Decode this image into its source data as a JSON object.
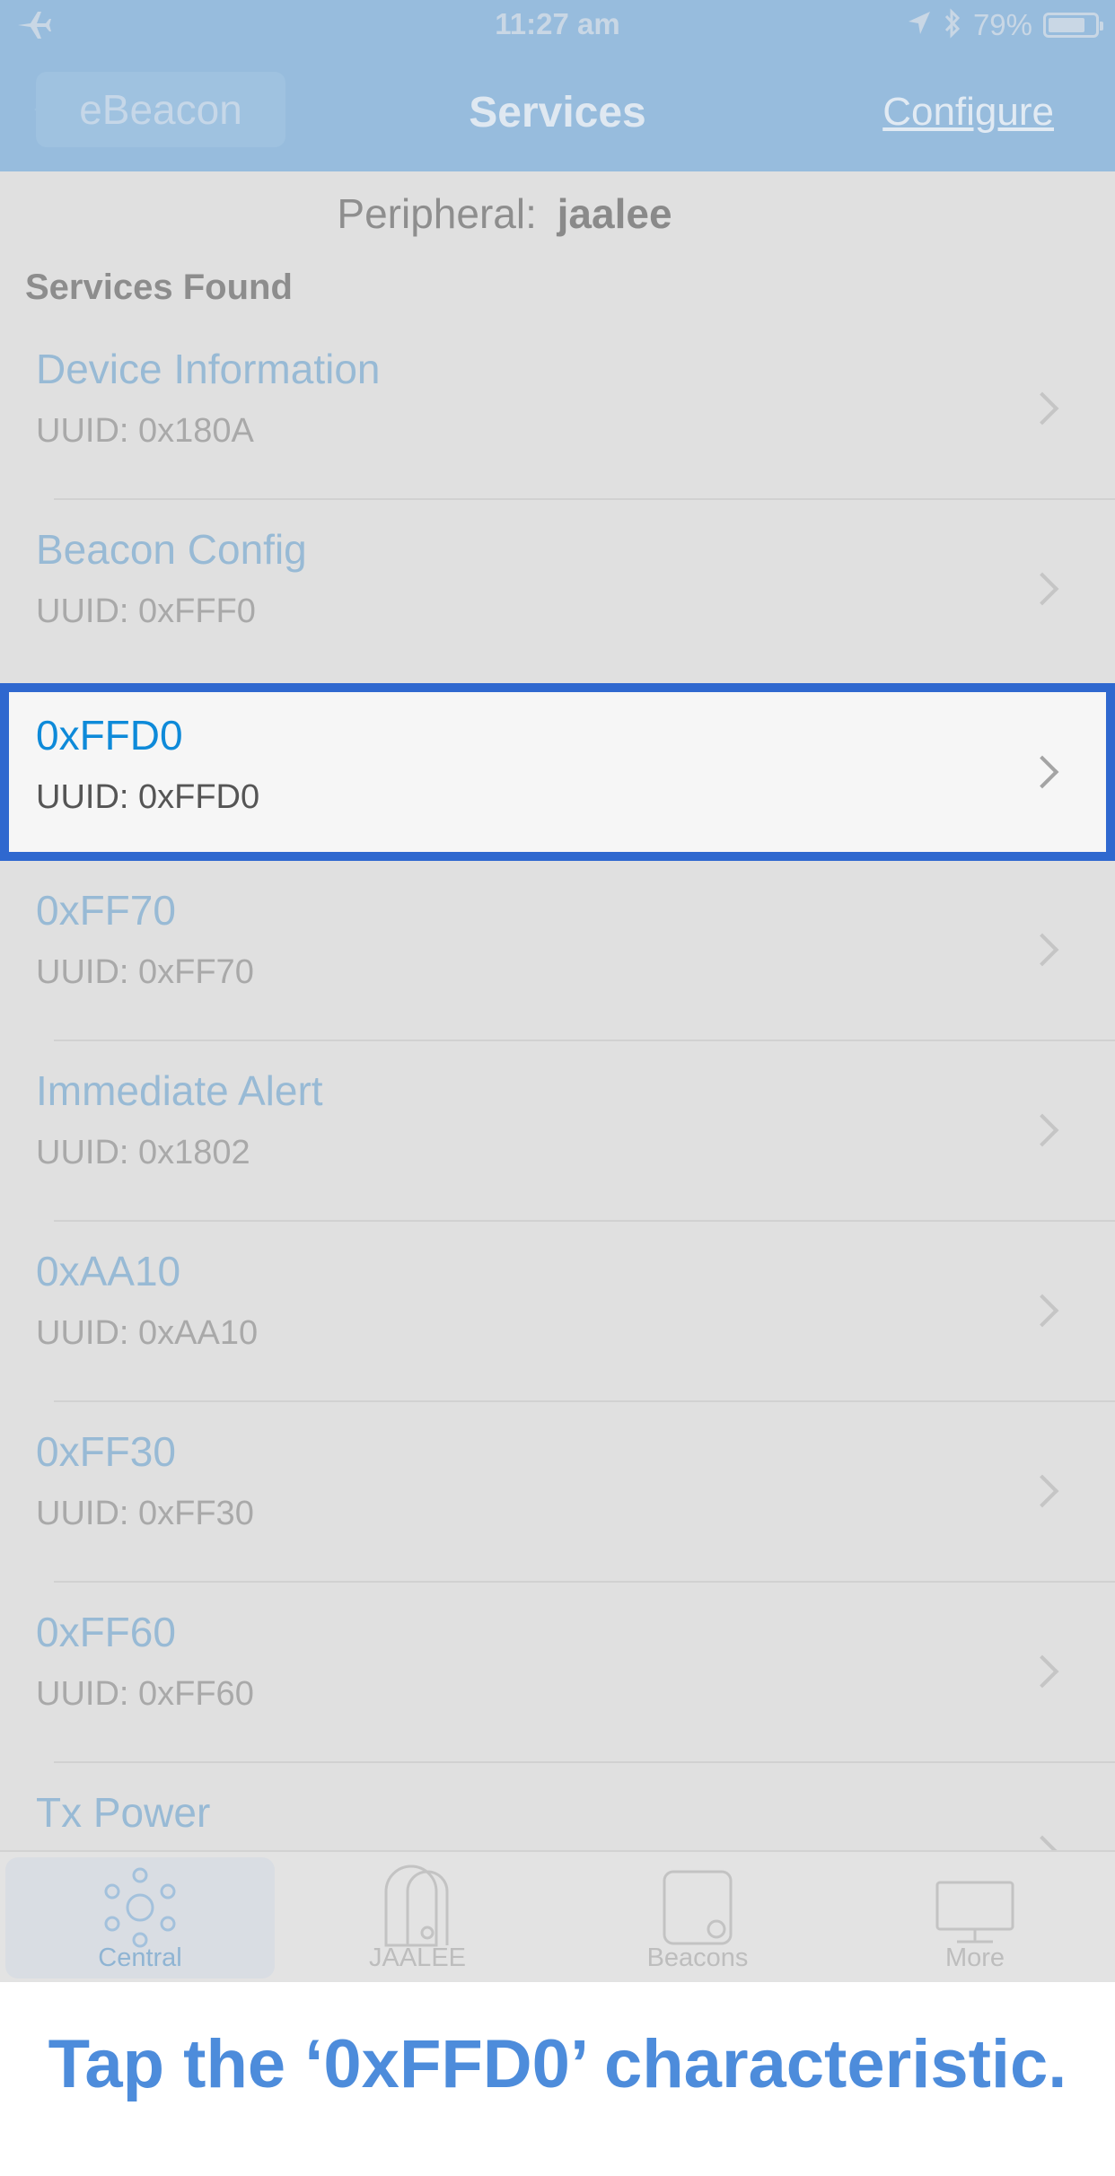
{
  "status_bar": {
    "time": "11:27 am",
    "battery_percent": "79%",
    "battery_level": 0.79,
    "icons": [
      "airplane-icon",
      "location-arrow-icon",
      "bluetooth-icon",
      "battery-icon"
    ]
  },
  "nav": {
    "back_label": "eBeacon",
    "title": "Services",
    "configure_label": "Configure"
  },
  "peripheral": {
    "label": "Peripheral:",
    "value": "jaalee"
  },
  "section_header": "Services Found",
  "services": [
    {
      "name": "Device Information",
      "uuid": "UUID: 0x180A"
    },
    {
      "name": "Beacon Config",
      "uuid": "UUID: 0xFFF0"
    },
    {
      "name": "0xFFD0",
      "uuid": "UUID: 0xFFD0",
      "highlighted": true
    },
    {
      "name": "0xFF70",
      "uuid": "UUID: 0xFF70"
    },
    {
      "name": "Immediate Alert",
      "uuid": "UUID: 0x1802"
    },
    {
      "name": "0xAA10",
      "uuid": "UUID: 0xAA10"
    },
    {
      "name": "0xFF30",
      "uuid": "UUID: 0xFF30"
    },
    {
      "name": "0xFF60",
      "uuid": "UUID: 0xFF60"
    },
    {
      "name": "Tx Power",
      "uuid": ""
    }
  ],
  "tabs": [
    {
      "label": "Central",
      "active": true
    },
    {
      "label": "JAALEE"
    },
    {
      "label": "Beacons"
    },
    {
      "label": "More"
    }
  ],
  "caption": "Tap the ‘0xFFD0’ characteristic.",
  "colors": {
    "nav_bg": "#97bcdd",
    "highlight_border": "#2f68cf",
    "caption_text": "#4d8cdb",
    "service_name": "#0e8ad9"
  }
}
